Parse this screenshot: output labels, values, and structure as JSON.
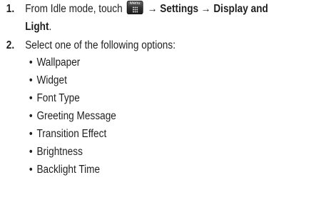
{
  "steps": [
    {
      "number": "1.",
      "prefix": "From Idle mode, touch",
      "icon_name": "menu-icon",
      "icon_label": "Menu",
      "arrow": "→",
      "path_line1": "Settings → Display and",
      "path_line2": "Light",
      "suffix": "."
    },
    {
      "number": "2.",
      "text": "Select one of the following options:"
    }
  ],
  "bullet_glyph": "•",
  "options": [
    "Wallpaper",
    "Widget",
    "Font Type",
    "Greeting Message",
    "Transition Effect",
    "Brightness",
    "Backlight Time"
  ]
}
